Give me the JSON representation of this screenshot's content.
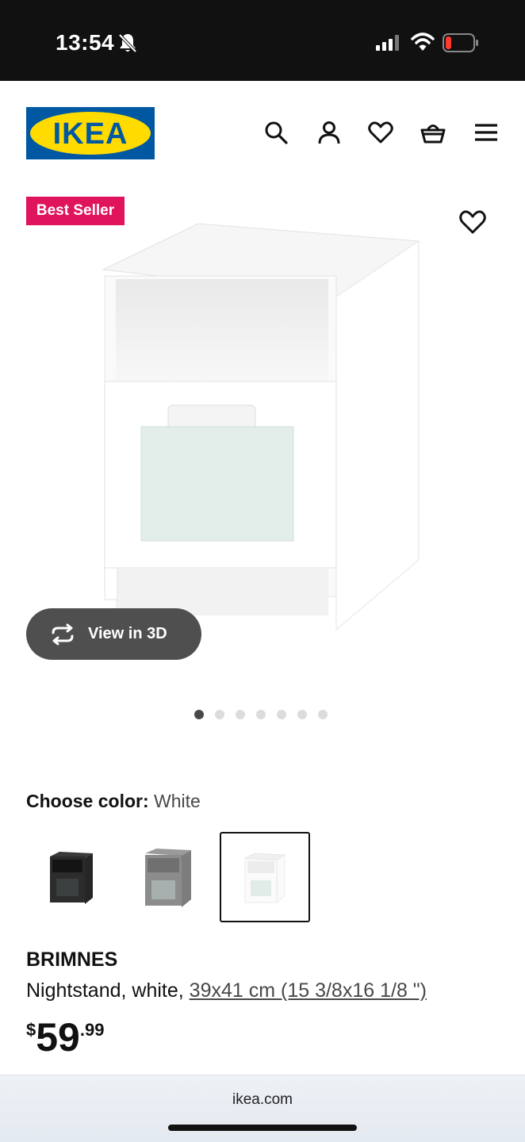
{
  "status_bar": {
    "time": "13:54",
    "icons": [
      "bell-slash-icon",
      "signal-icon",
      "wifi-icon",
      "battery-low-icon"
    ]
  },
  "header": {
    "logo_text": "IKEA",
    "icons": [
      "search-icon",
      "account-icon",
      "heart-icon",
      "basket-icon",
      "menu-icon"
    ]
  },
  "product": {
    "badge": "Best Seller",
    "view_3d_label": "View in 3D",
    "image_count": 7,
    "active_image": 1,
    "choose_color_label": "Choose color:",
    "selected_color": "White",
    "colors": [
      "black-brown",
      "gray",
      "white"
    ],
    "name": "BRIMNES",
    "description": "Nightstand, white,",
    "dimensions": "39x41 cm (15 3/8x16 1/8 \")",
    "price_currency": "$",
    "price_integer": "59",
    "price_decimal": ".99"
  },
  "browser": {
    "url": "ikea.com"
  },
  "colors": {
    "badge": "#e0135d",
    "ikea_blue": "#0058a3",
    "ikea_yellow": "#ffdb00",
    "view3d_bg": "#4f4f4f"
  }
}
